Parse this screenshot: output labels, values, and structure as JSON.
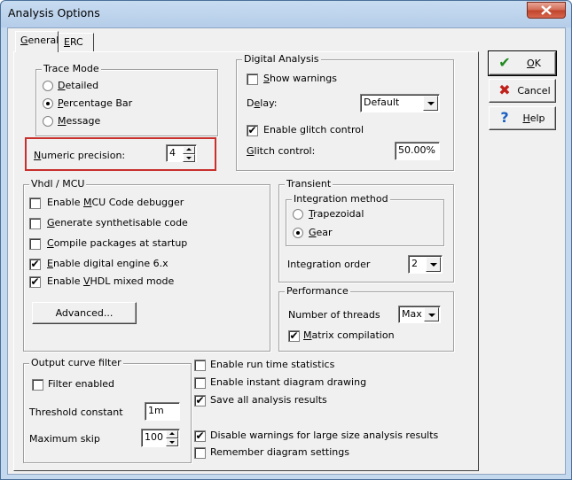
{
  "window": {
    "title": "Analysis Options"
  },
  "tabs": [
    {
      "label": "General",
      "underline": "G",
      "rest": "eneral"
    },
    {
      "label": "ERC",
      "underline": "E",
      "rest": "RC"
    }
  ],
  "buttons": {
    "ok": {
      "label": "OK",
      "u": "O",
      "rest": "K"
    },
    "cancel": {
      "label": "Cancel"
    },
    "help": {
      "label": "Help",
      "u": "H",
      "rest": "elp"
    }
  },
  "trace_mode": {
    "title": "Trace Mode",
    "options": [
      {
        "label": "Detailed",
        "u": "D",
        "rest": "etailed",
        "selected": false
      },
      {
        "label": "Percentage Bar",
        "u": "P",
        "rest": "ercentage Bar",
        "selected": true
      },
      {
        "label": "Message",
        "u": "M",
        "rest": "essage",
        "selected": false
      }
    ]
  },
  "numeric_precision": {
    "label": "Numeric precision:",
    "u": "N",
    "rest": "umeric precision:",
    "value": "4"
  },
  "digital_analysis": {
    "title": "Digital Analysis",
    "show_warnings": {
      "label": "Show warnings",
      "u": "S",
      "rest": "how warnings",
      "checked": false
    },
    "delay": {
      "label": "Delay:",
      "pre": "D",
      "u": "e",
      "rest": "lay:",
      "value": "Default"
    },
    "enable_glitch": {
      "label": "Enable glitch control",
      "checked": true
    },
    "glitch_control": {
      "label": "Glitch control:",
      "u": "G",
      "rest": "litch control:",
      "value": "50.00%"
    }
  },
  "vhdl": {
    "title": "Vhdl / MCU",
    "items": [
      {
        "label": "Enable MCU Code debugger",
        "pre": "Enable ",
        "u": "M",
        "rest": "CU Code debugger",
        "checked": false
      },
      {
        "label": "Generate synthetisable code",
        "pre": "",
        "u": "G",
        "rest": "enerate synthetisable code",
        "checked": false
      },
      {
        "label": "Compile packages at startup",
        "pre": "",
        "u": "C",
        "rest": "ompile packages at startup",
        "checked": false
      },
      {
        "label": "Enable digital engine 6.x",
        "pre": "",
        "u": "E",
        "rest": "nable digital engine 6.x",
        "checked": true
      },
      {
        "label": "Enable VHDL mixed mode",
        "pre": "Enable ",
        "u": "V",
        "rest": "HDL mixed mode",
        "checked": true
      }
    ],
    "advanced_button": "Advanced..."
  },
  "transient": {
    "title": "Transient",
    "integration_method": {
      "title": "Integration method",
      "options": [
        {
          "label": "Trapezoidal",
          "u": "T",
          "rest": "rapezoidal",
          "selected": false
        },
        {
          "label": "Gear",
          "u": "G",
          "rest": "ear",
          "selected": true
        }
      ]
    },
    "integration_order": {
      "label": "Integration order",
      "value": "2"
    }
  },
  "performance": {
    "title": "Performance",
    "threads": {
      "label": "Number of threads",
      "value": "Max"
    },
    "matrix": {
      "label": "Matrix compilation",
      "u": "M",
      "rest": "atrix compilation",
      "checked": true
    }
  },
  "output_curve": {
    "title": "Output curve filter",
    "filter_enabled": {
      "label": "Filter enabled",
      "checked": false
    },
    "threshold": {
      "label": "Threshold constant",
      "value": "1m"
    },
    "max_skip": {
      "label": "Maximum skip",
      "value": "100"
    }
  },
  "misc": [
    {
      "label": "Enable run time statistics",
      "checked": false
    },
    {
      "label": "Enable instant diagram drawing",
      "checked": false
    },
    {
      "label": "Save all analysis results",
      "checked": true
    },
    {
      "label": "Disable warnings for large size analysis results",
      "checked": true
    },
    {
      "label": "Remember diagram settings",
      "checked": false
    }
  ]
}
